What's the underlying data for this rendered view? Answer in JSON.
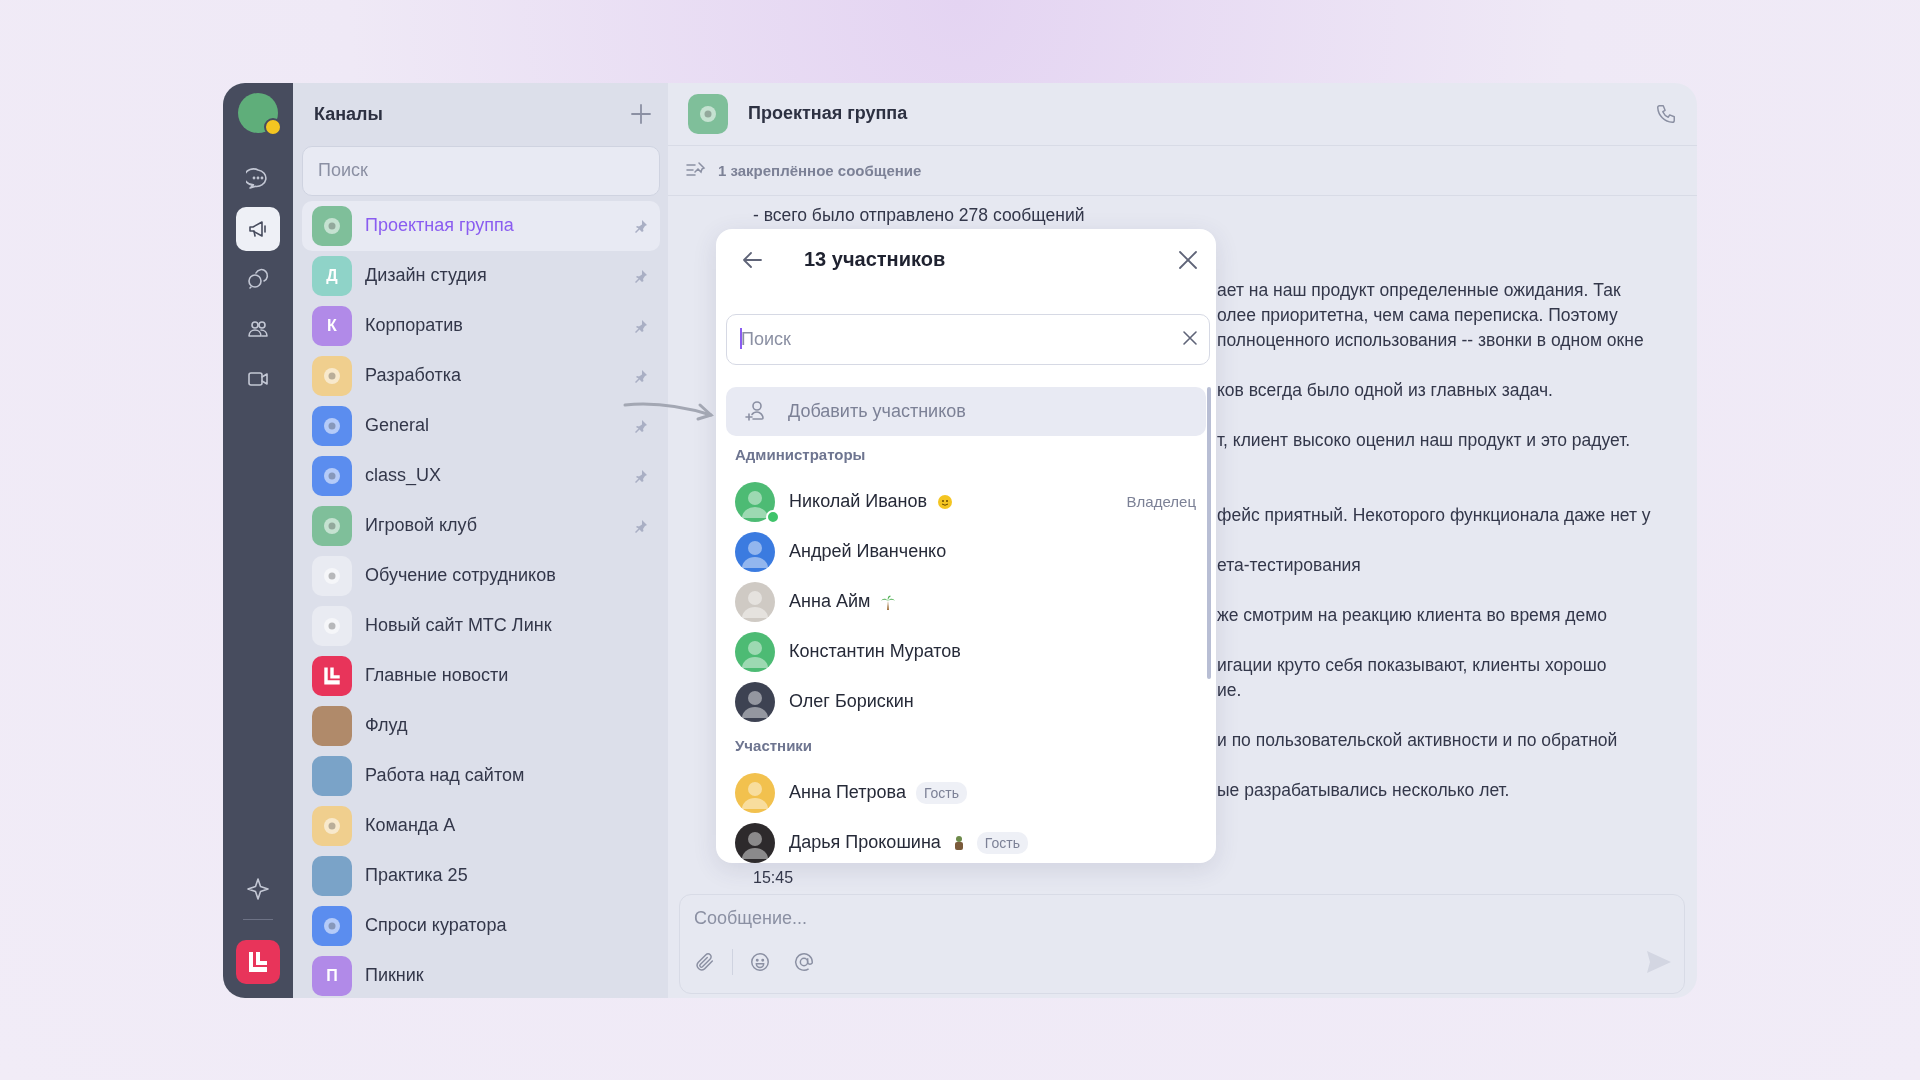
{
  "rail": {
    "items": [
      {
        "kind": "chat",
        "selected": false
      },
      {
        "kind": "channels",
        "selected": true
      },
      {
        "kind": "threads",
        "selected": false
      },
      {
        "kind": "contacts",
        "selected": false
      },
      {
        "kind": "video",
        "selected": false
      }
    ]
  },
  "channels": {
    "title": "Каналы",
    "search": {
      "placeholder": "Поиск"
    },
    "items": [
      {
        "name": "Проектная группа",
        "kind": "icon",
        "color": "#7fbf9a",
        "pinned": true,
        "selected": true
      },
      {
        "name": "Дизайн студия",
        "kind": "letter",
        "letter": "Д",
        "color": "#8fd3c8",
        "pinned": true,
        "selected": false
      },
      {
        "name": "Корпоратив",
        "kind": "letter",
        "letter": "К",
        "color": "#b18ae8",
        "pinned": true,
        "selected": false
      },
      {
        "name": "Разработка",
        "kind": "icon",
        "color": "#f0cf8e",
        "pinned": true,
        "selected": false
      },
      {
        "name": "General",
        "kind": "icon",
        "color": "#5b8def",
        "pinned": true,
        "selected": false
      },
      {
        "name": "class_UX",
        "kind": "icon",
        "color": "#5b8def",
        "pinned": true,
        "selected": false
      },
      {
        "name": "Игровой клуб",
        "kind": "icon",
        "color": "#7fbf9a",
        "pinned": true,
        "selected": false
      },
      {
        "name": "Обучение сотрудников",
        "kind": "icon",
        "color": "#e9ebf2",
        "pinned": false,
        "selected": false
      },
      {
        "name": "Новый сайт МТС Линк",
        "kind": "icon",
        "color": "#e9ebf2",
        "pinned": false,
        "selected": false
      },
      {
        "name": "Главные новости",
        "kind": "logo",
        "color": "#e8345a",
        "pinned": false,
        "selected": false
      },
      {
        "name": "Флуд",
        "kind": "photo",
        "color": "#b08a6a",
        "pinned": false,
        "selected": false
      },
      {
        "name": "Работа над сайтом",
        "kind": "photo",
        "color": "#7aa3c8",
        "pinned": false,
        "selected": false
      },
      {
        "name": "Команда А",
        "kind": "icon",
        "color": "#f0cf8e",
        "pinned": false,
        "selected": false
      },
      {
        "name": "Практика 25",
        "kind": "photo",
        "color": "#7aa3c8",
        "pinned": false,
        "selected": false
      },
      {
        "name": "Спроси куратора",
        "kind": "icon",
        "color": "#5b8def",
        "pinned": false,
        "selected": false
      },
      {
        "name": "Пикник",
        "kind": "letter",
        "letter": "П",
        "color": "#b18ae8",
        "pinned": false,
        "selected": false
      }
    ]
  },
  "chat": {
    "title": "Проектная группа",
    "pinned_bar": "1 закреплённое сообщение",
    "first_line": "- всего было отправлено 278 сообщений",
    "fragments": [
      [
        "ает на наш продукт определенные ожидания. Так",
        "олее приоритетна, чем сама переписка. Поэтому",
        "полноценного использования -- звонки в одном окне"
      ],
      [
        "ков всегда было одной из главных задач."
      ],
      [
        "т, клиент высоко оценил наш продукт и это радует."
      ],
      [
        "фейс приятный. Некоторого функционала даже нет у"
      ],
      [
        "ета-тестирования"
      ],
      [
        "же смотрим на реакцию клиента во время демо"
      ],
      [
        "игации круто себя показывают, клиенты хорошо",
        "ие."
      ],
      [
        "и по пользовательской активности и по обратной"
      ],
      [
        "ые разрабатывались несколько лет."
      ]
    ],
    "time": "15:45",
    "composer": {
      "placeholder": "Сообщение..."
    }
  },
  "members_panel": {
    "title": "13 участников",
    "search": {
      "placeholder": "Поиск",
      "focused": true
    },
    "add_label": "Добавить участников",
    "groups": [
      {
        "title": "Администраторы",
        "members": [
          {
            "name": "Николай Иванов",
            "color": "#4dbb74",
            "online": true,
            "kind": "smile",
            "role": "Владелец"
          },
          {
            "name": "Андрей Иванченко",
            "color": "#3b7be0",
            "online": false
          },
          {
            "name": "Анна Айм",
            "color": "#cfcac4",
            "online": false,
            "kind": "palm"
          },
          {
            "name": "Константин Муратов",
            "color": "#4dbb74",
            "online": false
          },
          {
            "name": "Олег Борискин",
            "color": "#3d4252",
            "online": false
          }
        ]
      },
      {
        "title": "Участники",
        "members": [
          {
            "name": "Анна Петрова",
            "color": "#f2c14e",
            "online": false,
            "badge": "Гость"
          },
          {
            "name": "Дарья Прокошина",
            "color": "#2d2a2c",
            "online": false,
            "kind": "figure",
            "badge": "Гость"
          }
        ]
      }
    ]
  }
}
